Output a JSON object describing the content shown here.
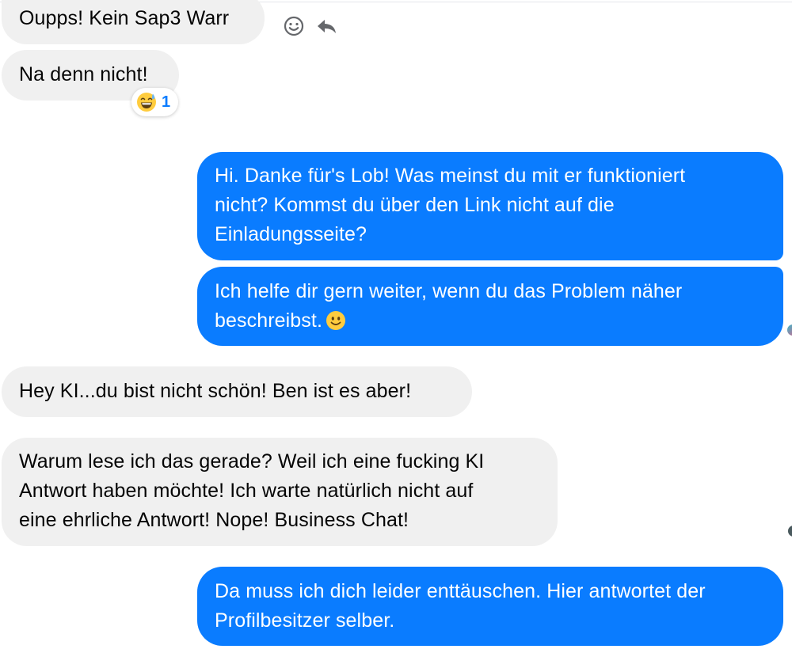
{
  "conversation": {
    "messages": [
      {
        "id": "m1",
        "direction": "incoming",
        "lines": [
          "Oupps! Kein Sap3 Warr"
        ]
      },
      {
        "id": "m2",
        "direction": "incoming",
        "lines": [
          "Na denn nicht!"
        ],
        "reaction": {
          "emoji": "grinning-sweat-emoji",
          "count": "1"
        }
      },
      {
        "id": "m3",
        "direction": "outgoing",
        "lines": [
          "Hi. Danke für's Lob! Was meinst du mit er funktioniert",
          "nicht? Kommst du über den Link nicht auf die",
          "Einladungsseite?"
        ]
      },
      {
        "id": "m4",
        "direction": "outgoing",
        "lines": [
          "Ich helfe dir gern weiter, wenn du das Problem näher",
          "beschreibst."
        ],
        "trailing_emoji": "smiling-face-emoji"
      },
      {
        "id": "m5",
        "direction": "incoming",
        "lines": [
          "Hey KI...du bist nicht schön! Ben ist es aber!"
        ]
      },
      {
        "id": "m6",
        "direction": "incoming",
        "lines": [
          "Warum lese ich das gerade? Weil ich eine fucking KI",
          "Antwort haben möchte! Ich warte natürlich nicht auf",
          "eine ehrliche Antwort! Nope! Business Chat!"
        ]
      },
      {
        "id": "m7",
        "direction": "outgoing",
        "lines": [
          "Da muss ich dich leider enttäuschen. Hier antwortet der",
          "Profilbesitzer selber."
        ]
      }
    ]
  },
  "actions": {
    "icons": [
      "smiley-reaction-icon",
      "reply-arrow-icon"
    ]
  },
  "colors": {
    "outgoing_bubble": "#0a7cff",
    "incoming_bubble": "#f0f0f0",
    "incoming_text": "#050505",
    "reaction_count": "#0a7cff"
  }
}
